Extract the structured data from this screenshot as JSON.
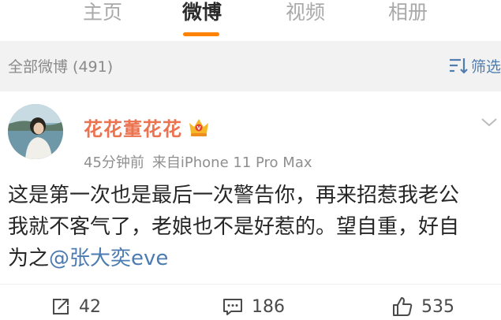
{
  "tabs": [
    {
      "label": "主页"
    },
    {
      "label": "微博"
    },
    {
      "label": "视频"
    },
    {
      "label": "相册"
    }
  ],
  "active_tab": "微博",
  "accent_color": "#ff8200",
  "filter_bar": {
    "count_label": "全部微博 (491)",
    "filter_label": "筛选",
    "filter_icon": "filter-icon"
  },
  "post": {
    "username": "花花董花花",
    "badge_icon": "vip-crown-icon",
    "time": "45分钟前",
    "source": "来自iPhone 11 Pro Max",
    "text_line1": "这是第一次也是最后一次警告你，再来招惹我老公",
    "text_line2": "我就不客气了，老娘也不是好惹的。望自重，好自",
    "text_line3_prefix": "为之",
    "mention": "@张大奕eve",
    "username_color": "#eb7350",
    "mention_color": "#4b7bb0"
  },
  "actions": {
    "repost_count": "42",
    "comment_count": "186",
    "like_count": "535"
  }
}
